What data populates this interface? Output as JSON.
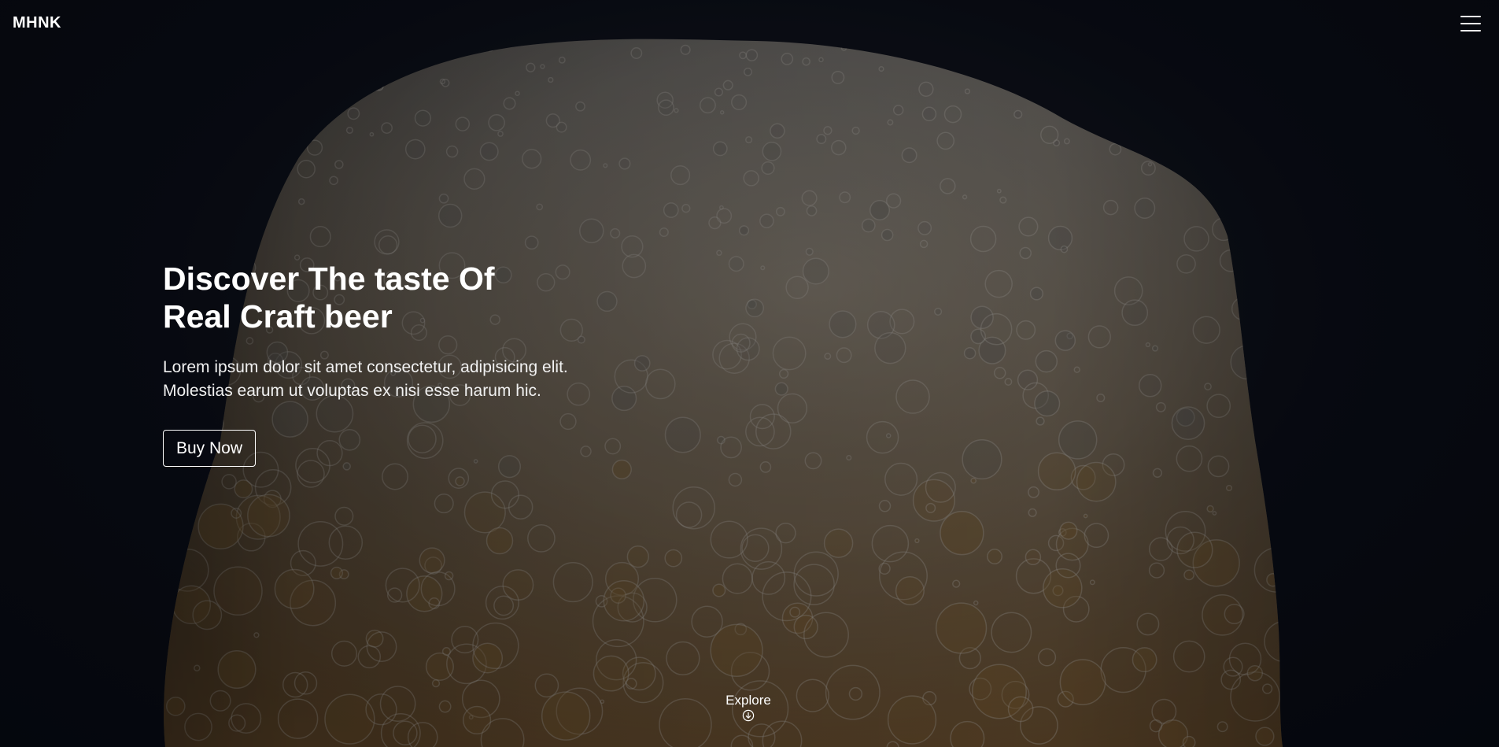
{
  "header": {
    "brand": "MHNK",
    "menu_icon": "hamburger-menu-icon"
  },
  "hero": {
    "title_line1": "Discover The taste Of",
    "title_line2": "Real Craft beer",
    "description": "Lorem ipsum dolor sit amet consectetur, adipisicing elit. Molestias earum ut voluptas ex nisi esse harum hic.",
    "cta_label": "Buy Now",
    "background_image": "beer-foam-photo"
  },
  "explore": {
    "label": "Explore",
    "icon": "arrow-down-circle-icon"
  },
  "colors": {
    "background": "#070a12",
    "foam_light": "#8f8c86",
    "foam_dark": "#3a3835",
    "beer_amber": "#6b4a1e",
    "text": "#ffffff"
  }
}
